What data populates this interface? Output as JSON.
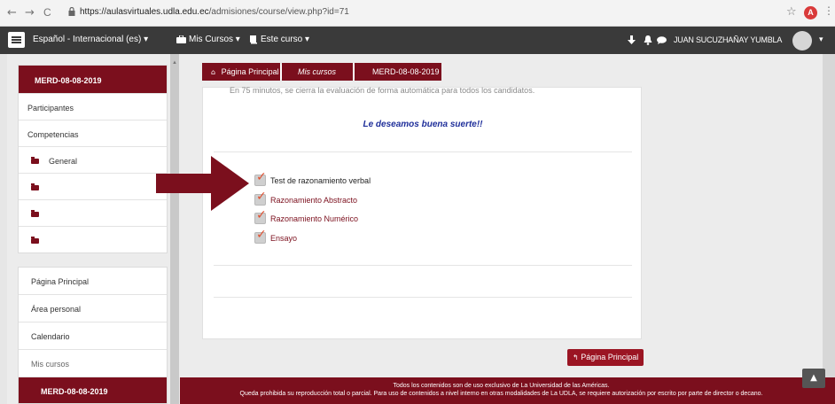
{
  "browser": {
    "back_icon": "arrow-left-icon",
    "back": "←",
    "forward": "→",
    "reload": "C",
    "url_domain": "https://aulasvirtuales.udla.edu.ec",
    "url_path": "/admisiones/course/view.php?id=71",
    "star": "☆",
    "profile_initial": "A",
    "menu": "⋮"
  },
  "topnav": {
    "language": "Español - Internacional (es) ▾",
    "my_courses": "Mis Cursos ▾",
    "this_course": "Este curso ▾",
    "user_name": "JUAN SUCUZHAÑAY YUMBLA",
    "user_caret": "▾"
  },
  "sidebar": {
    "course_title": "MERD-08-08-2019",
    "items": [
      {
        "label": "Participantes",
        "folder": false
      },
      {
        "label": "Competencias",
        "folder": false
      },
      {
        "label": "General",
        "folder": true
      },
      {
        "label": "",
        "folder": true
      },
      {
        "label": "",
        "folder": true
      },
      {
        "label": "",
        "folder": true
      }
    ],
    "nav": [
      "Página Principal",
      "Área personal",
      "Calendario",
      "Mis cursos"
    ],
    "active": "MERD-08-08-2019"
  },
  "breadcrumb": {
    "home": "Página Principal",
    "courses": "Mis cursos",
    "current": "MERD-08-08-2019"
  },
  "main": {
    "cut_text": "En 75 minutos, se cierra la evaluación de forma automática para todos los candidatos.",
    "luck": "Le deseamos buena suerte!!",
    "activities": [
      {
        "label": "Test de razonamiento verbal",
        "color": "#222222"
      },
      {
        "label": "Razonamiento Abstracto",
        "color": "#7b0f1d"
      },
      {
        "label": "Razonamiento Numérico",
        "color": "#7b0f1d"
      },
      {
        "label": "Ensayo",
        "color": "#7b0f1d"
      }
    ],
    "home_button": "Página Principal"
  },
  "footer": {
    "line1": "Todos los contenidos son de uso exclusivo de La Universidad de las Américas.",
    "line2": "Queda prohibida su reproducción total o parcial. Para uso de contenidos a nivel interno en otras modalidades de La UDLA, se requiere autorización por escrito por parte de director o decano."
  },
  "colors": {
    "brand": "#7b0f1d",
    "topbar": "#3a3a3a",
    "annotation_arrow": "#7b0f1d",
    "check": "#e05030"
  }
}
